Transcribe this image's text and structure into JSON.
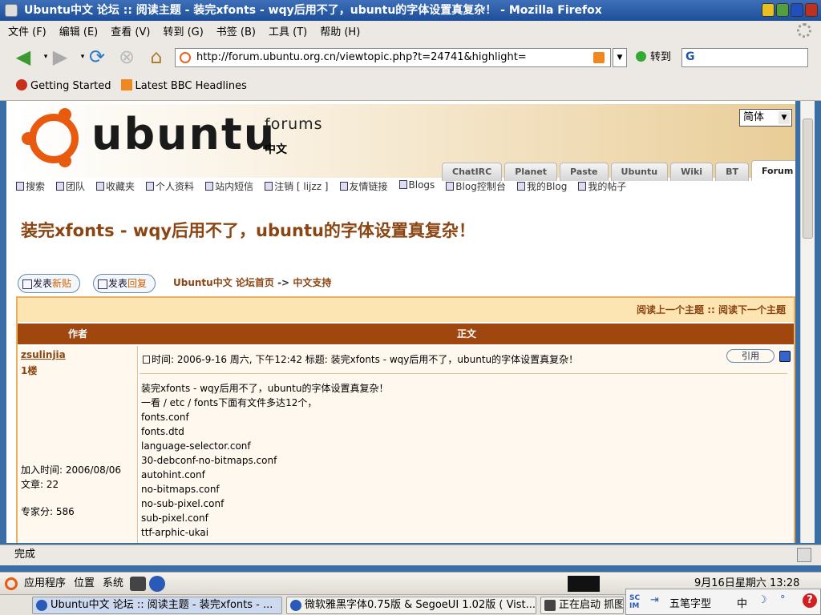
{
  "window": {
    "title": "Ubuntu中文 论坛 :: 阅读主题 - 装完xfonts - wqy后用不了，ubuntu的字体设置真复杂！ - Mozilla Firefox"
  },
  "menu": [
    "文件 (F)",
    "编辑 (E)",
    "查看 (V)",
    "转到 (G)",
    "书签 (B)",
    "工具 (T)",
    "帮助 (H)"
  ],
  "toolbar": {
    "url": "http://forum.ubuntu.org.cn/viewtopic.php?t=24741&highlight=",
    "go_label": "转到",
    "search_engine": "G"
  },
  "bookmarks": [
    "Getting Started",
    "Latest BBC Headlines"
  ],
  "banner": {
    "logo": "ubuntu",
    "forums": "forums",
    "cn": "中文",
    "lang_select": "简体"
  },
  "tabs": [
    "ChatIRC",
    "Planet",
    "Paste",
    "Ubuntu",
    "Wiki",
    "BT",
    "Forum"
  ],
  "active_tab": "Forum",
  "toplinks": [
    "搜索",
    "团队",
    "收藏夹",
    "个人资料",
    "站内短信",
    "注销 [ lijzz ]",
    "友情链接",
    "Blogs",
    "Blog控制台",
    "我的Blog",
    "我的帖子"
  ],
  "topic_title": "装完xfonts - wqy后用不了，ubuntu的字体设置真复杂！",
  "buttons": {
    "new_post_a": "发表",
    "new_post_b": "新贴",
    "reply_a": "发表",
    "reply_b": "回复"
  },
  "breadcrumb": {
    "home": "Ubuntu中文 论坛首页",
    "sep": "->",
    "section": "中文支持"
  },
  "forum_nav": {
    "prev": "阅读上一个主题",
    "sep": "::",
    "next": "阅读下一个主题"
  },
  "columns": {
    "author": "作者",
    "body": "正文"
  },
  "post": {
    "author": "zsulinjia",
    "floor": "1楼",
    "joined": "加入时间: 2006/08/06",
    "posts": "文章: 22",
    "score": "专家分: 586",
    "header": "时间: 2006-9-16 周六, 下午12:42    标题: 装完xfonts - wqy后用不了，ubuntu的字体设置真复杂！",
    "quote": "引用",
    "lines": [
      "装完xfonts - wqy后用不了，ubuntu的字体设置真复杂！",
      "一看 / etc / fonts下面有文件多达12个，",
      "fonts.conf",
      "fonts.dtd",
      "language-selector.conf",
      "30-debconf-no-bitmaps.conf",
      "autohint.conf",
      "no-bitmaps.conf",
      "no-sub-pixel.conf",
      "sub-pixel.conf",
      "ttf-arphic-ukai"
    ]
  },
  "status": "完成",
  "panel": {
    "apps": "应用程序",
    "places": "位置",
    "system": "系统",
    "clock": "9月16日星期六 13:28"
  },
  "taskbar": [
    "Ubuntu中文 论坛 :: 阅读主题 - 装完xfonts - ...",
    "微软雅黑字体0.75版 & SegoeUI 1.02版 ( Vist...",
    "正在启动 抓图"
  ],
  "ime": {
    "logo": "SC IM",
    "mode": "五笔字型",
    "lang": "中"
  },
  "colors": {
    "accent": "#8b4513",
    "header_bg": "#a0460f",
    "ubuntu_orange": "#e85a10"
  }
}
